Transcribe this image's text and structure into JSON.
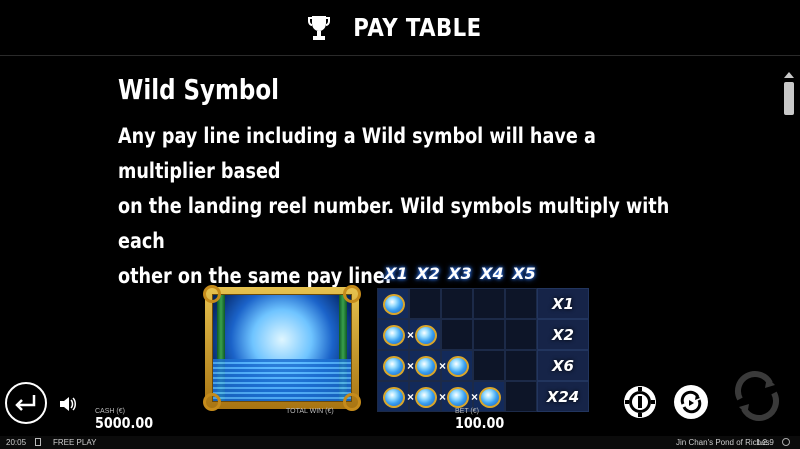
{
  "header": {
    "title": "PAY TABLE",
    "icon": "trophy-icon"
  },
  "section": {
    "title": "Wild Symbol",
    "line1": "Any pay line including a Wild symbol will have a multiplier based",
    "line2": "on the landing reel number. Wild symbols multiply with each",
    "line3": "other on the same pay line."
  },
  "multiplier_table": {
    "columns": [
      "X1",
      "X2",
      "X3",
      "X4",
      "X5"
    ],
    "rows": [
      {
        "wilds": 1,
        "result": "X1"
      },
      {
        "wilds": 2,
        "result": "X2"
      },
      {
        "wilds": 3,
        "result": "X6"
      },
      {
        "wilds": 4,
        "result": "X24"
      }
    ],
    "separator": "×"
  },
  "hud": {
    "cash_label": "CASH (€)",
    "cash_value": "5000.00",
    "total_win_label": "TOTAL WIN (€)",
    "bet_label": "BET (€)",
    "bet_value": "100.00"
  },
  "footer": {
    "time": "20:05",
    "mode": "FREE PLAY",
    "game_name": "Jin Chan's Pond of Riches",
    "version": "1.2.9"
  },
  "colors": {
    "gold": "#d9a62a",
    "grid_bg": "#0d1528",
    "glow": "#2d6fe0"
  }
}
